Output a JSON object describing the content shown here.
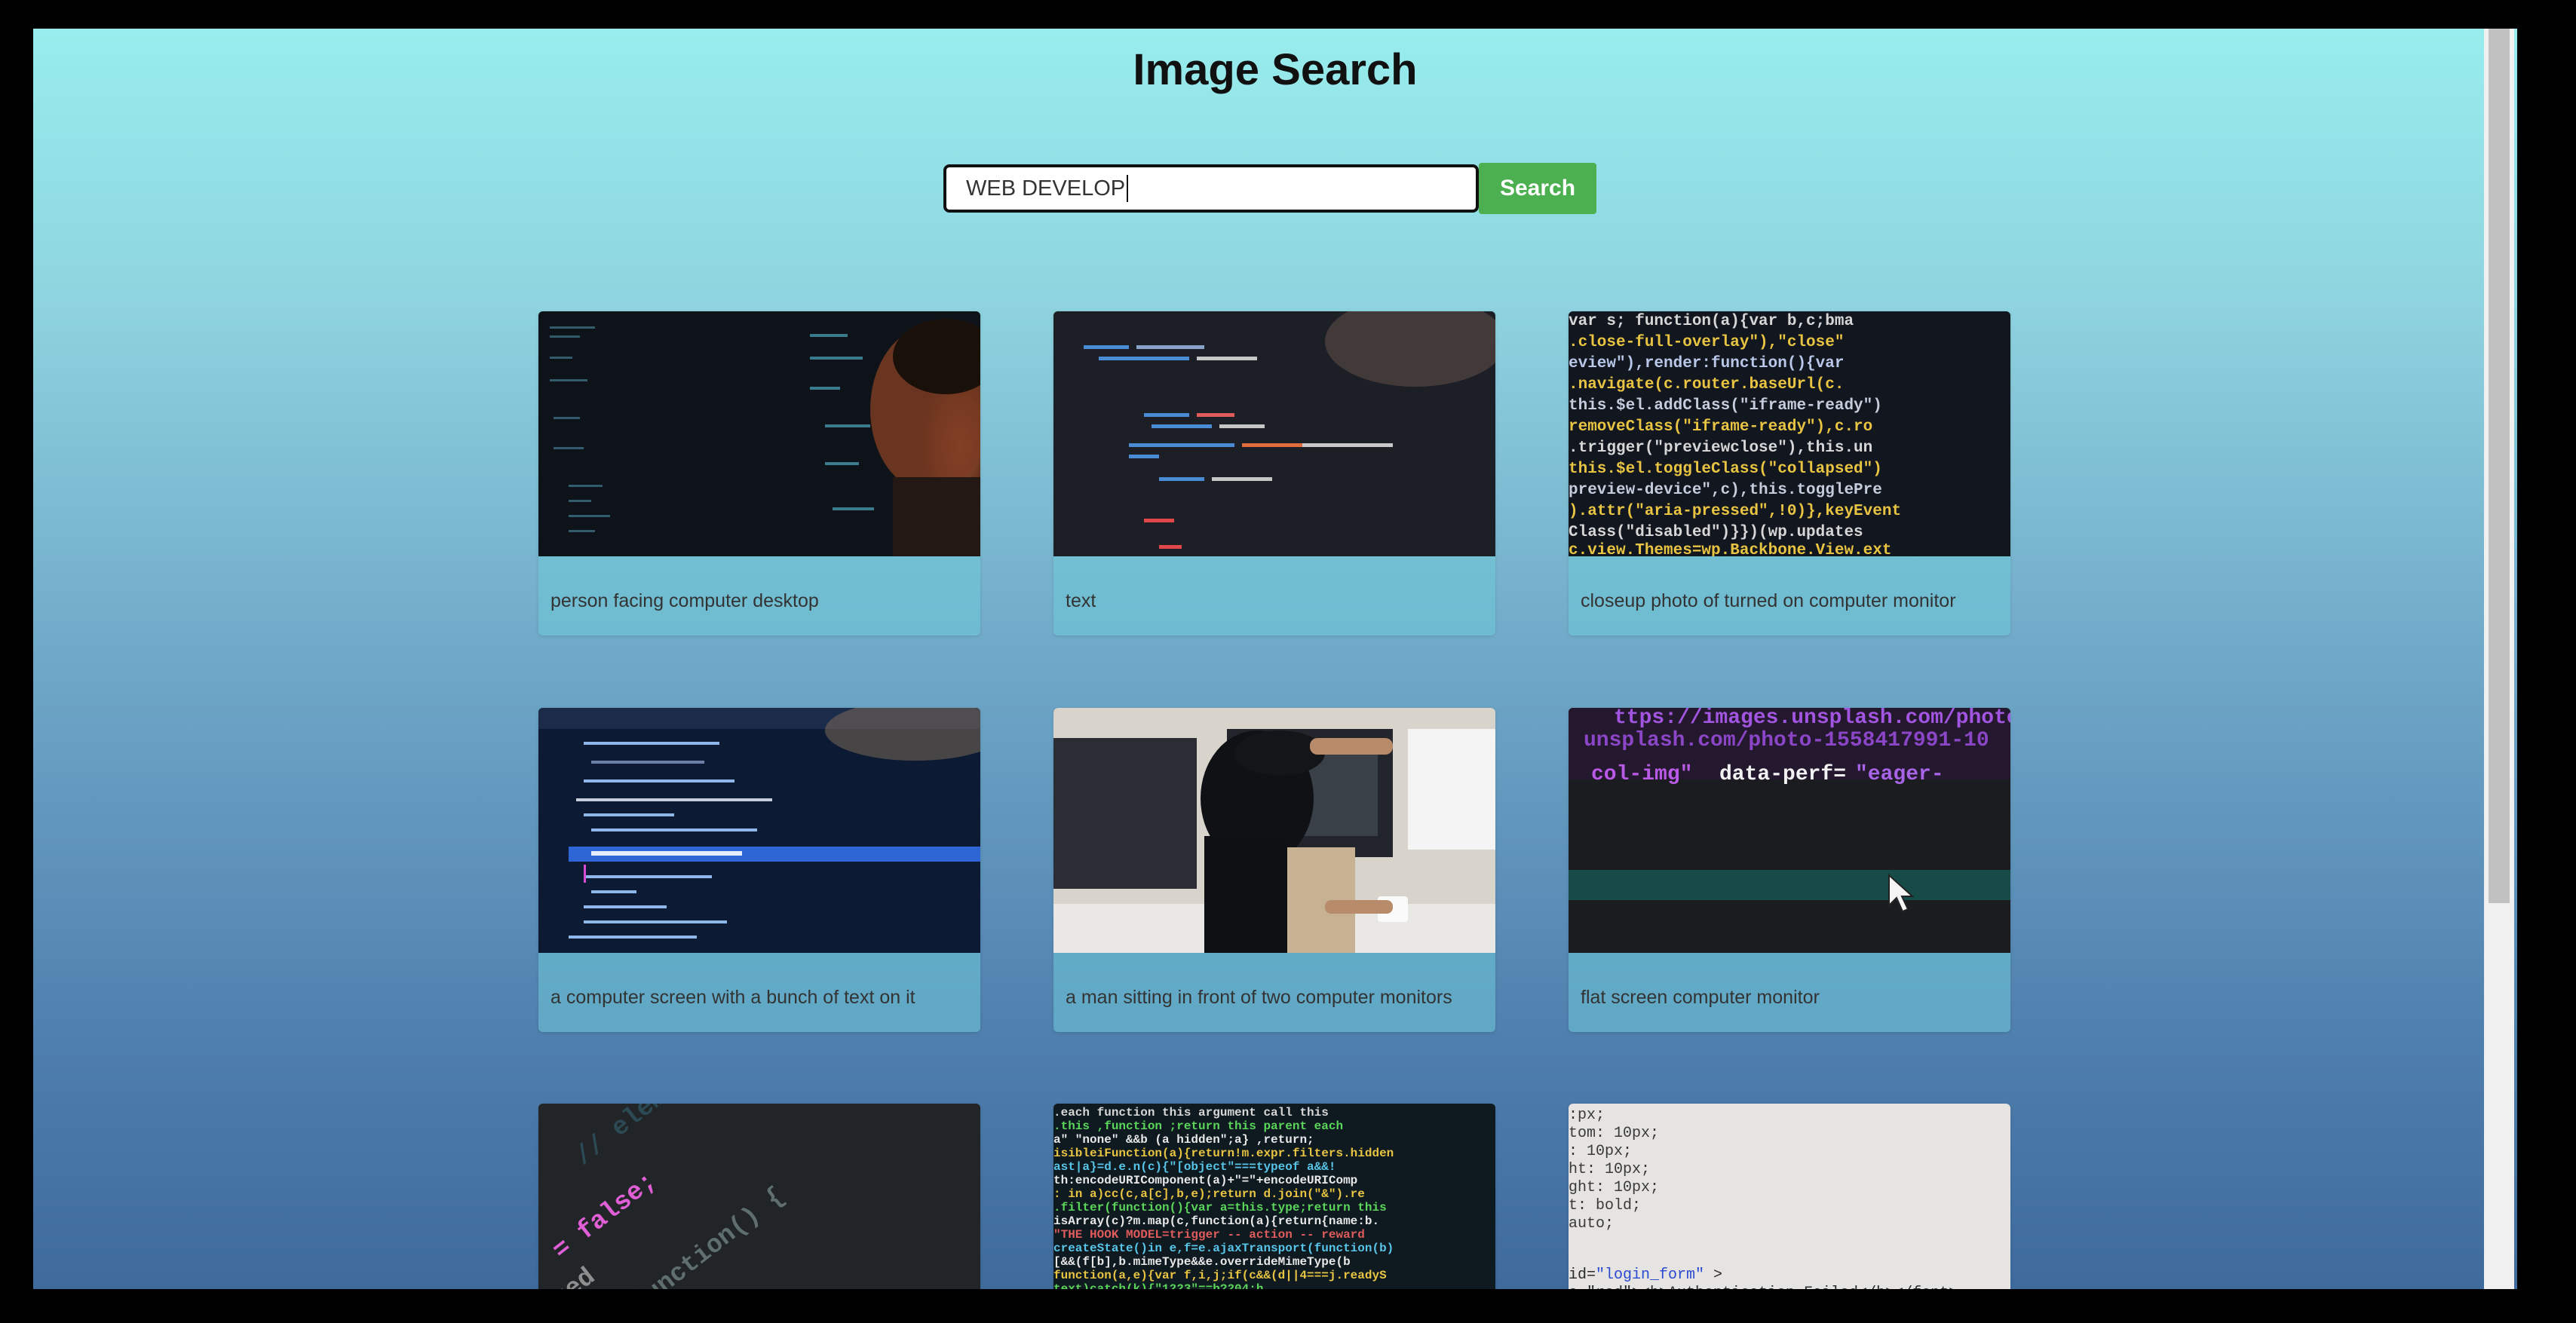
{
  "page": {
    "title": "Image Search"
  },
  "search": {
    "value": "WEB DEVELOP",
    "button_label": "Search"
  },
  "results": [
    {
      "caption": "person facing computer desktop"
    },
    {
      "caption": "text"
    },
    {
      "caption": "closeup photo of turned on computer monitor"
    },
    {
      "caption": "a computer screen with a bunch of text on it"
    },
    {
      "caption": "a man sitting in front of two computer monitors"
    },
    {
      "caption": "flat screen computer monitor"
    },
    {
      "caption": ""
    },
    {
      "caption": ""
    },
    {
      "caption": ""
    }
  ],
  "colors": {
    "search_button": "#4caf50",
    "background_top": "#98eded",
    "background_bottom": "#3e6a9c"
  }
}
